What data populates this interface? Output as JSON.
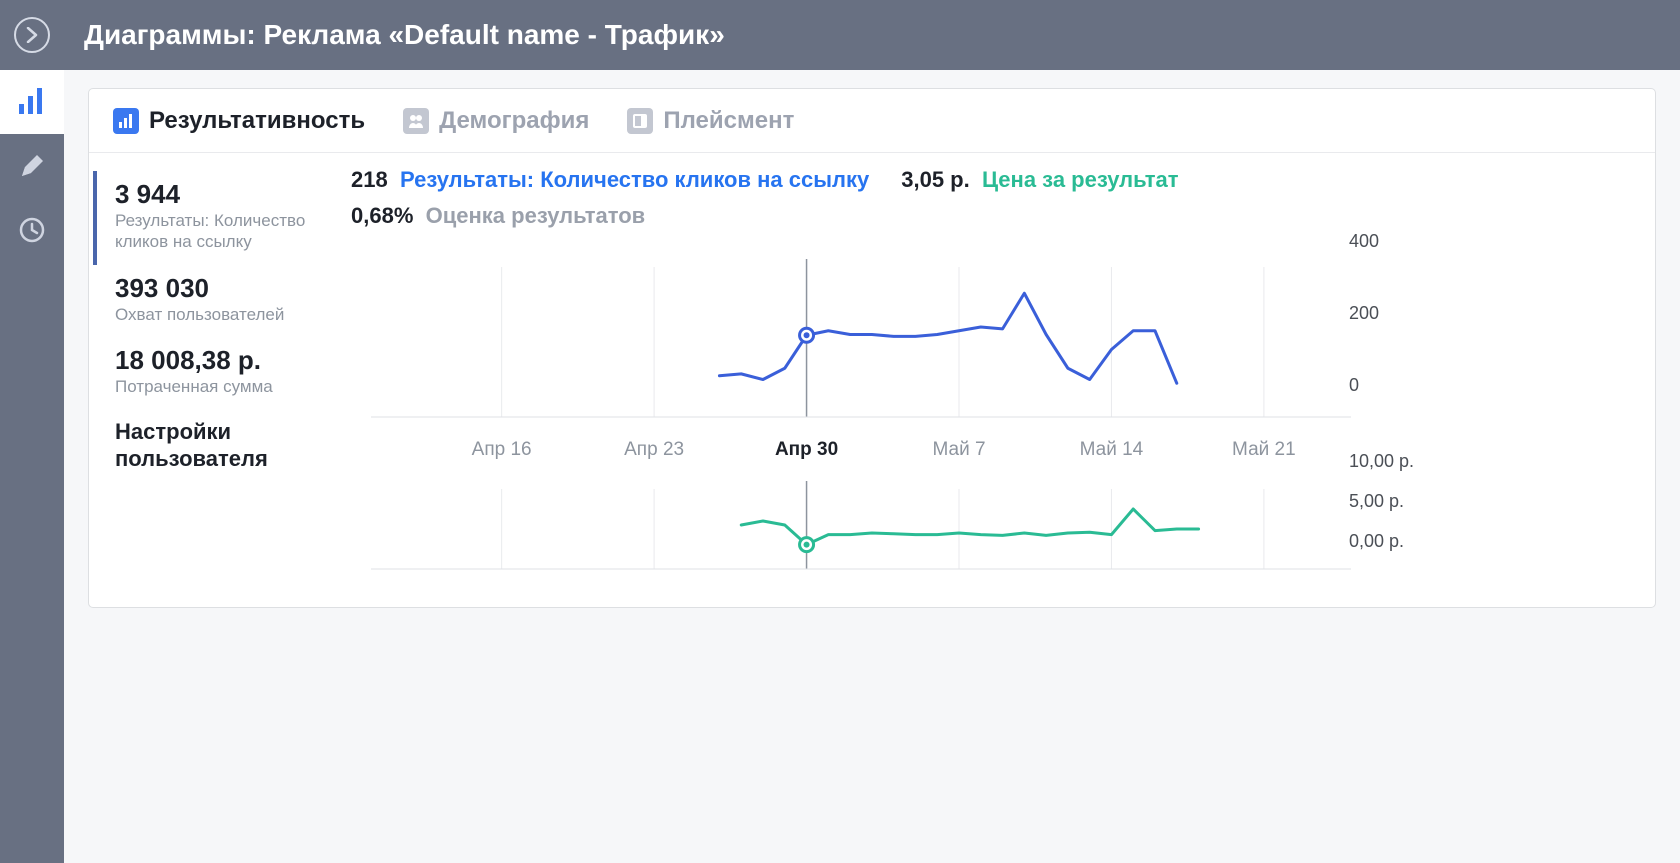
{
  "header": {
    "title": "Диаграммы: Реклама «Default name - Трафик»"
  },
  "sidebar": {
    "items": [
      "analytics",
      "edit",
      "history"
    ]
  },
  "tabs": [
    {
      "label": "Результативность",
      "icon": "bars",
      "active": true
    },
    {
      "label": "Демография",
      "icon": "people",
      "active": false
    },
    {
      "label": "Плейсмент",
      "icon": "layout",
      "active": false
    }
  ],
  "stats": {
    "results": {
      "value": "3 944",
      "label": "Результаты: Количество кликов на ссылку"
    },
    "reach": {
      "value": "393 030",
      "label": "Охват пользователей"
    },
    "spent": {
      "value": "18 008,38 р.",
      "label": "Потраченная сумма"
    },
    "settings_title": "Настройки пользователя"
  },
  "chart_header": {
    "results_value": "218",
    "results_label": "Результаты: Количество кликов на ссылку",
    "cost_value": "3,05 р.",
    "cost_label": "Цена за результат",
    "rate_value": "0,68%",
    "rate_label": "Оценка результатов"
  },
  "chart_data": [
    {
      "type": "line",
      "title": "Результаты",
      "x_labels": [
        "Апр 16",
        "Апр 23",
        "Апр 30",
        "Май 7",
        "Май 14",
        "Май 21"
      ],
      "series": [
        {
          "name": "Результаты: Количество кликов на ссылку",
          "color": "#3a5fd9",
          "x": [
            "Апр 26",
            "Апр 27",
            "Апр 28",
            "Апр 29",
            "Апр 30",
            "Май 1",
            "Май 2",
            "Май 3",
            "Май 4",
            "Май 5",
            "Май 6",
            "Май 7",
            "Май 8",
            "Май 9",
            "Май 10",
            "Май 11",
            "Май 12",
            "Май 13",
            "Май 14",
            "Май 15",
            "Май 16",
            "Май 17"
          ],
          "values": [
            110,
            115,
            100,
            130,
            218,
            230,
            220,
            220,
            215,
            215,
            220,
            230,
            240,
            235,
            330,
            220,
            130,
            100,
            180,
            230,
            230,
            90
          ]
        }
      ],
      "ylim": [
        0,
        400
      ],
      "yticks": [
        0,
        200,
        400
      ],
      "highlight_x": "Апр 30",
      "highlight_y": 218
    },
    {
      "type": "line",
      "title": "Цена за результат",
      "x_labels": [
        "Апр 16",
        "Апр 23",
        "Апр 30",
        "Май 7",
        "Май 14",
        "Май 21"
      ],
      "series": [
        {
          "name": "Цена за результат",
          "color": "#2abb94",
          "x": [
            "Апр 27",
            "Апр 28",
            "Апр 29",
            "Апр 30",
            "Май 1",
            "Май 2",
            "Май 3",
            "Май 4",
            "Май 5",
            "Май 6",
            "Май 7",
            "Май 8",
            "Май 9",
            "Май 10",
            "Май 11",
            "Май 12",
            "Май 13",
            "Май 14",
            "Май 15",
            "Май 16",
            "Май 17",
            "Май 18"
          ],
          "values": [
            5.5,
            6.0,
            5.5,
            3.05,
            4.3,
            4.3,
            4.5,
            4.4,
            4.3,
            4.3,
            4.5,
            4.3,
            4.2,
            4.5,
            4.2,
            4.5,
            4.6,
            4.3,
            7.5,
            4.8,
            5.0,
            5.0
          ]
        }
      ],
      "ylim": [
        0,
        10
      ],
      "yticks": [
        "0,00 р.",
        "5,00 р.",
        "10,00 р."
      ],
      "highlight_x": "Апр 30",
      "highlight_y": 3.05
    }
  ]
}
